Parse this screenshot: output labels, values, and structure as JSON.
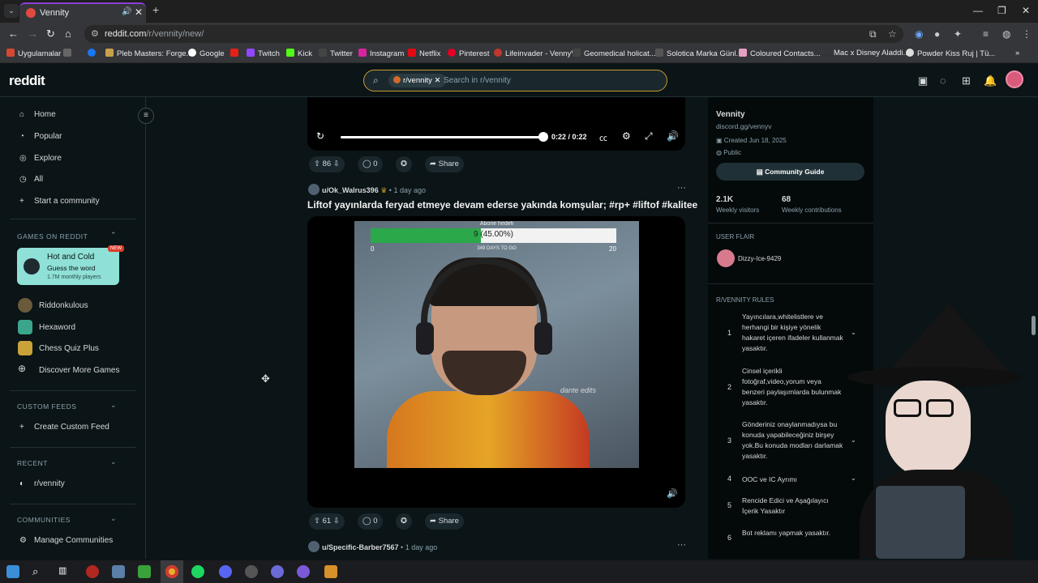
{
  "browser": {
    "tab_title": "Vennity",
    "url_host": "reddit.com",
    "url_path": "/r/vennity/new/",
    "bookmarks": [
      "Uygulamalar",
      "Pleb Masters: Forge...",
      "Google",
      "Twitch",
      "Kick",
      "Twitter",
      "Instagram",
      "Netflix",
      "Pinterest",
      "Lifeinvader - VennyV",
      "Geomedical holicat...",
      "Solotica Marka Günl...",
      "Coloured Contacts...",
      "Mac x Disney Aladdi...",
      "Powder Kiss Ruj | Tü..."
    ]
  },
  "header": {
    "logo": "reddit",
    "search_chip": "r/vennity",
    "search_placeholder": "Search in r/vennity"
  },
  "sidebar": {
    "nav": [
      "Home",
      "Popular",
      "Explore",
      "All",
      "Start a community"
    ],
    "games_header": "GAMES ON REDDIT",
    "featured_game": {
      "title": "Hot and Cold",
      "subtitle": "Guess the word",
      "players": "1.7M monthly players",
      "badge": "NEW"
    },
    "games": [
      "Riddonkulous",
      "Hexaword",
      "Chess Quiz Plus",
      "Discover More Games"
    ],
    "custom_feeds_header": "CUSTOM FEEDS",
    "create_custom_feed": "Create Custom Feed",
    "recent_header": "RECENT",
    "recent": [
      "r/vennity"
    ],
    "communities_header": "COMMUNITIES",
    "manage_communities": "Manage Communities"
  },
  "player": {
    "time": "0:22 / 0:22",
    "progress": 1.0
  },
  "posts": [
    {
      "votes": "86",
      "comments": "0",
      "share": "Share"
    },
    {
      "author": "u/Ok_Walrus396",
      "age": "1 day ago",
      "title": "Liftof yayınlarda feryad etmeye devam ederse yakında komşular; #rp+ #liftof #kalitee",
      "video": {
        "overlay_header": "Abone hedefi",
        "goal_text": "9 (45.00%)",
        "goal_fraction": 0.45,
        "goal_min": "0",
        "goal_max": "20",
        "days_left": "349 DAYS TO GO",
        "watermark": "dante edits"
      },
      "votes": "61",
      "comments": "0",
      "share": "Share"
    },
    {
      "author": "u/Specific-Barber7567",
      "age": "1 day ago"
    }
  ],
  "community": {
    "name": "Vennity",
    "link": "discord.gg/vennyv",
    "created": "Created Jun 18, 2025",
    "visibility": "Public",
    "guide_label": "Community Guide",
    "visitors": "2.1K",
    "visitors_label": "Weekly visitors",
    "contributions": "68",
    "contributions_label": "Weekly contributions",
    "flair_header": "USER FLAIR",
    "flair_user": "Dizzy-Ice-9429",
    "rules_header": "R/VENNITY RULES",
    "rules": [
      {
        "n": "1",
        "text": "Yayıncılara,whitelistlere ve herhangi bir kişiye yönelik hakaret içeren ifadeler kullanmak yasaktır."
      },
      {
        "n": "2",
        "text": "Cinsel içerikli fotoğraf,video,yorum veya benzeri paylaşımlarda bulunmak yasaktır."
      },
      {
        "n": "3",
        "text": "Gönderiniz onaylanmadıysa bu konuda yapabileceğiniz birşey yok.Bu konuda modları darlamak yasaktır."
      },
      {
        "n": "4",
        "text": "OOC ve IC Ayrımı"
      },
      {
        "n": "5",
        "text": "Rencide Edici ve Aşağılayıcı İçerik Yasaktır"
      },
      {
        "n": "6",
        "text": "Bot reklamı yapmak yasaktır."
      }
    ]
  },
  "colors": {
    "accent": "#c99a2e",
    "progress_green": "#2aa84a",
    "bg": "#0b1416"
  }
}
